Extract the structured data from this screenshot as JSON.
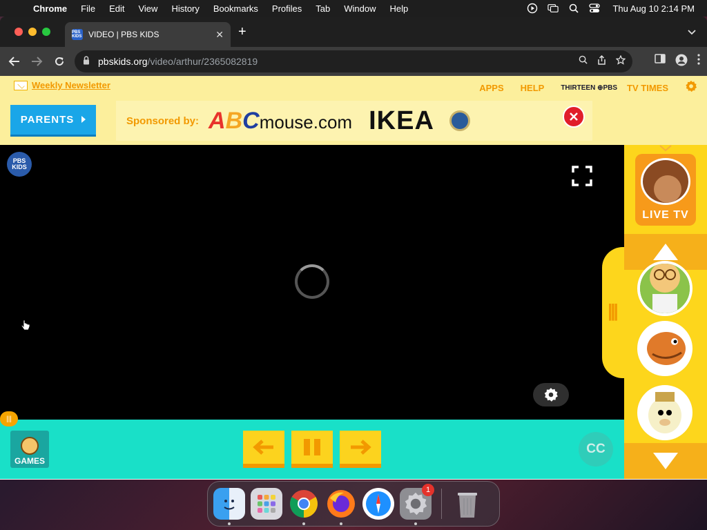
{
  "menubar": {
    "app_name": "Chrome",
    "menus": [
      "File",
      "Edit",
      "View",
      "History",
      "Bookmarks",
      "Profiles",
      "Tab",
      "Window",
      "Help"
    ],
    "datetime": "Thu Aug 10  2:14 PM"
  },
  "browser": {
    "tab_title": "VIDEO | PBS KIDS",
    "favicon_text": "PBS KIDS",
    "url_host": "pbskids.org",
    "url_path": "/video/arthur/2365082819"
  },
  "page": {
    "newsletter_label": "Weekly Newsletter",
    "top_links": {
      "apps": "APPS",
      "help": "HELP",
      "station": "THIRTEEN ⊕PBS",
      "tv_times": "TV TIMES"
    },
    "parents_label": "PARENTS",
    "sponsor_label": "Sponsored by:",
    "sponsor_abc": {
      "a": "A",
      "b": "B",
      "c": "C",
      "rest": "mouse.com"
    },
    "sponsor_ikea": "IKEA",
    "pbs_badge": {
      "line1": "PBS",
      "line2": "KIDS"
    },
    "games_label": "GAMES",
    "cc_label": "CC",
    "live_tv_label": "LIVE TV"
  },
  "dock": {
    "apps": [
      "finder",
      "launchpad",
      "chrome",
      "firefox",
      "safari",
      "system-settings",
      "trash"
    ],
    "settings_badge": "1"
  },
  "colors": {
    "brand_yellow": "#fdd61c",
    "teal_bar": "#19e0c8",
    "orange": "#f29900",
    "parents_blue": "#1aa6e8",
    "close_red": "#e11d2a"
  }
}
